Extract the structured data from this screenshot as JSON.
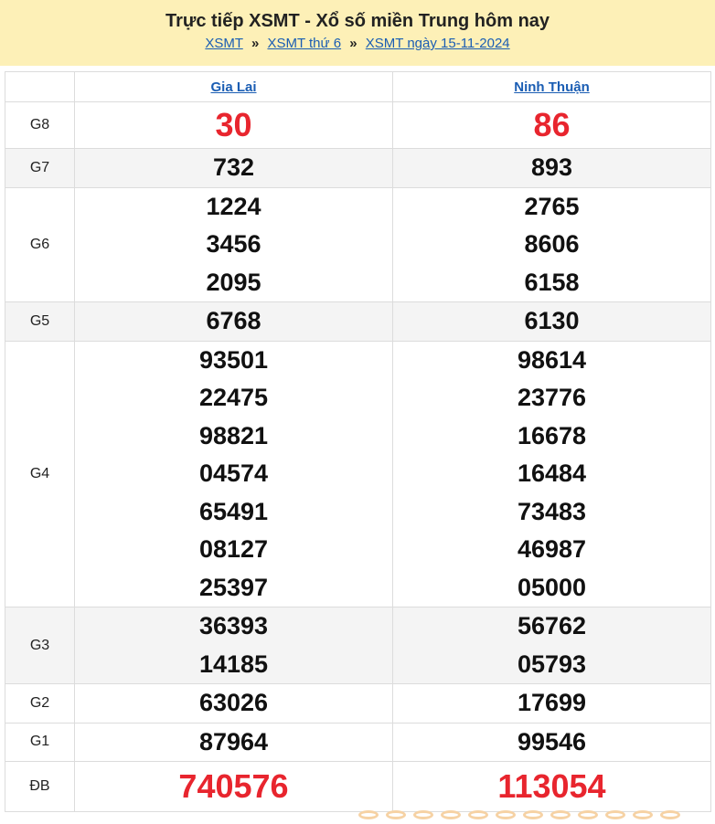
{
  "header": {
    "title": "Trực tiếp XSMT - Xổ số miền Trung hôm nay",
    "breadcrumbs": [
      "XSMT",
      "XSMT thứ 6",
      "XSMT ngày 15-11-2024"
    ],
    "separator": "»"
  },
  "provinces": [
    "Gia Lai",
    "Ninh Thuận"
  ],
  "prizes": [
    {
      "label": "G8",
      "results": [
        [
          "30"
        ],
        [
          "86"
        ]
      ]
    },
    {
      "label": "G7",
      "results": [
        [
          "732"
        ],
        [
          "893"
        ]
      ]
    },
    {
      "label": "G6",
      "results": [
        [
          "1224",
          "3456",
          "2095"
        ],
        [
          "2765",
          "8606",
          "6158"
        ]
      ]
    },
    {
      "label": "G5",
      "results": [
        [
          "6768"
        ],
        [
          "6130"
        ]
      ]
    },
    {
      "label": "G4",
      "results": [
        [
          "93501",
          "22475",
          "98821",
          "04574",
          "65491",
          "08127",
          "25397"
        ],
        [
          "98614",
          "23776",
          "16678",
          "16484",
          "73483",
          "46987",
          "05000"
        ]
      ]
    },
    {
      "label": "G3",
      "results": [
        [
          "36393",
          "14185"
        ],
        [
          "56762",
          "05793"
        ]
      ]
    },
    {
      "label": "G2",
      "results": [
        [
          "63026"
        ],
        [
          "17699"
        ]
      ]
    },
    {
      "label": "G1",
      "results": [
        [
          "87964"
        ],
        [
          "99546"
        ]
      ]
    },
    {
      "label": "ĐB",
      "results": [
        [
          "740576"
        ],
        [
          "113054"
        ]
      ]
    }
  ],
  "colors": {
    "header_bg": "#fdf0b7",
    "link": "#1a5db3",
    "highlight_red": "#e8252e",
    "row_shade": "#f4f4f4"
  }
}
